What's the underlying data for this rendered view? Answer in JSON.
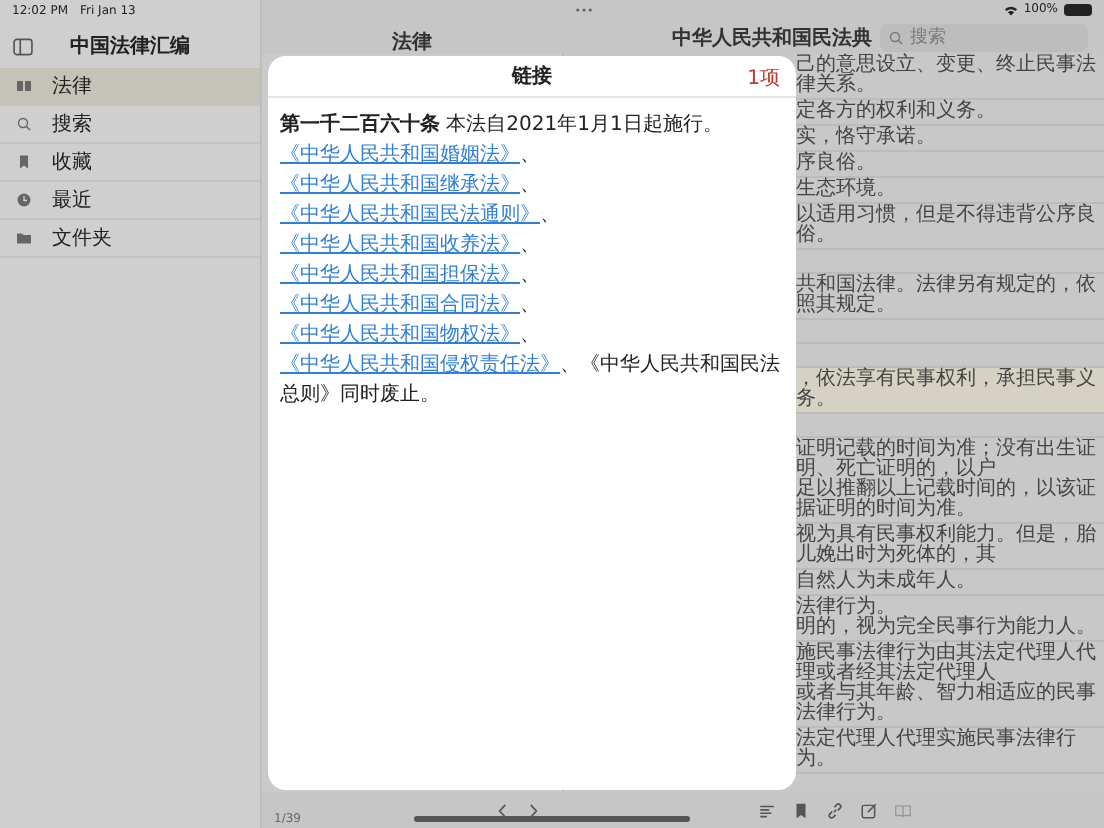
{
  "status_bar": {
    "time": "12:02 PM",
    "date": "Fri Jan 13",
    "battery": "100%"
  },
  "sidebar": {
    "title": "中国法律汇编",
    "items": [
      {
        "label": "法律",
        "selected": true
      },
      {
        "label": "搜索",
        "selected": false
      },
      {
        "label": "收藏",
        "selected": false
      },
      {
        "label": "最近",
        "selected": false
      },
      {
        "label": "文件夹",
        "selected": false
      }
    ]
  },
  "list_pane": {
    "title": "法律"
  },
  "content_pane": {
    "title": "中华人民共和国民法典",
    "search": {
      "placeholder": "搜索"
    },
    "rows": [
      {
        "lines": [
          "己的意思设立、变更、终止民事法律关系。"
        ],
        "highlighted": false
      },
      {
        "lines": [
          "定各方的权利和义务。"
        ],
        "highlighted": false
      },
      {
        "lines": [
          "实，恪守承诺。"
        ],
        "highlighted": false
      },
      {
        "lines": [
          "序良俗。"
        ],
        "highlighted": false
      },
      {
        "lines": [
          "生态环境。"
        ],
        "highlighted": false
      },
      {
        "lines": [
          "以适用习惯，但是不得违背公序良俗。"
        ],
        "highlighted": false
      },
      {
        "lines": [],
        "highlighted": false
      },
      {
        "lines": [
          "共和国法律。法律另有规定的，依照其规定。"
        ],
        "highlighted": false
      },
      {
        "lines": [],
        "highlighted": false
      },
      {
        "lines": [],
        "highlighted": false
      },
      {
        "lines": [
          "，依法享有民事权利，承担民事义务。"
        ],
        "highlighted": true
      },
      {
        "lines": [],
        "highlighted": false
      },
      {
        "lines": [
          "证明记载的时间为准；没有出生证明、死亡证明的，以户",
          "足以推翻以上记载时间的，以该证据证明的时间为准。"
        ],
        "highlighted": false
      },
      {
        "lines": [
          "视为具有民事权利能力。但是，胎儿娩出时为死体的，其"
        ],
        "highlighted": false
      },
      {
        "lines": [
          "自然人为未成年人。"
        ],
        "highlighted": false
      },
      {
        "lines": [
          "法律行为。",
          "明的，视为完全民事行为能力人。"
        ],
        "highlighted": false
      },
      {
        "lines": [
          "施民事法律行为由其法定代理人代理或者经其法定代理人",
          "或者与其年龄、智力相适应的民事法律行为。"
        ],
        "highlighted": false
      },
      {
        "lines": [
          "法定代理人代理实施民事法律行为。"
        ],
        "highlighted": false
      }
    ],
    "page_indicator": "1/39"
  },
  "toolbar": {
    "items": [
      {
        "kind": "prev",
        "disabled": false
      },
      {
        "kind": "next",
        "disabled": false
      },
      {
        "kind": "outline",
        "disabled": false
      },
      {
        "kind": "bookmark",
        "disabled": false
      },
      {
        "kind": "link",
        "disabled": false
      },
      {
        "kind": "note",
        "disabled": false
      },
      {
        "kind": "reader",
        "disabled": true
      }
    ]
  },
  "modal": {
    "title": "链接",
    "count": "1项",
    "paragraph": [
      {
        "kind": "text",
        "text": "**第一千二百六十条** 本法自2021年1月1日起施行。"
      },
      {
        "kind": "link",
        "text": "《中华人民共和国婚姻法》"
      },
      {
        "kind": "text",
        "text": "、"
      },
      {
        "kind": "link",
        "text": "《中华人民共和国继承法》"
      },
      {
        "kind": "text",
        "text": "、"
      },
      {
        "kind": "link",
        "text": "《中华人民共和国民法通则》"
      },
      {
        "kind": "text",
        "text": "、"
      },
      {
        "kind": "link",
        "text": "《中华人民共和国收养法》"
      },
      {
        "kind": "text",
        "text": "、"
      },
      {
        "kind": "link",
        "text": "《中华人民共和国担保法》"
      },
      {
        "kind": "text",
        "text": "、"
      },
      {
        "kind": "link",
        "text": "《中华人民共和国合同法》"
      },
      {
        "kind": "text",
        "text": "、"
      },
      {
        "kind": "link",
        "text": "《中华人民共和国物权法》"
      },
      {
        "kind": "text",
        "text": "、"
      },
      {
        "kind": "link",
        "text": "《中华人民共和国侵权责任法》"
      },
      {
        "kind": "text",
        "text": "、《中华人民共和国民法总则》同时废止。"
      }
    ]
  }
}
